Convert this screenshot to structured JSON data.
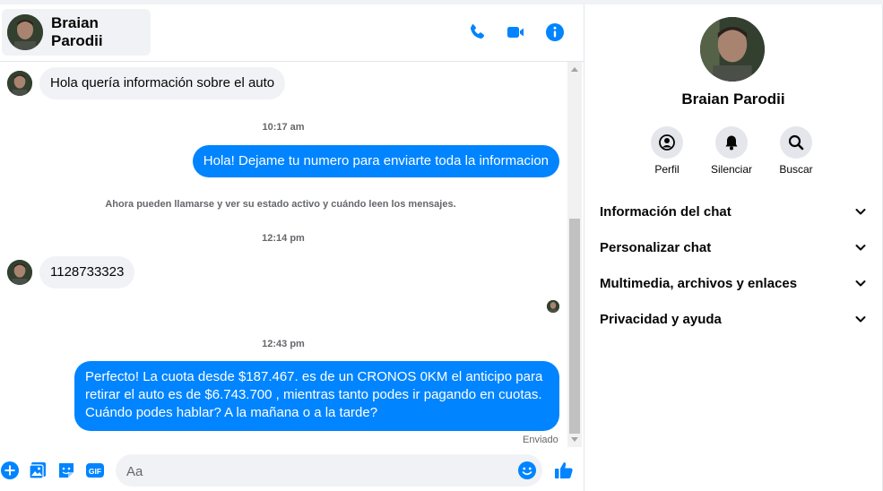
{
  "contact": {
    "name": "Braian Parodii"
  },
  "header": {
    "call_icon": "phone-icon",
    "video_icon": "video-camera-icon",
    "info_icon": "info-icon"
  },
  "messages": [
    {
      "type": "incoming",
      "text": "Hola quería información sobre el auto"
    },
    {
      "type": "timestamp",
      "text": "10:17 am"
    },
    {
      "type": "outgoing",
      "text": "Hola! Dejame tu numero  para enviarte toda la informacion"
    },
    {
      "type": "system",
      "text": "Ahora pueden llamarse y ver su estado activo y cuándo leen los mensajes."
    },
    {
      "type": "timestamp",
      "text": "12:14 pm"
    },
    {
      "type": "incoming",
      "text": "1128733323"
    },
    {
      "type": "timestamp",
      "text": "12:43 pm"
    },
    {
      "type": "outgoing",
      "text": "Perfecto! La cuota desde $187.467. es de un CRONOS 0KM el anticipo para retirar el auto es de $6.743.700 , mientras tanto podes ir pagando en cuotas. Cuándo podes hablar? A la mañana o a la tarde?"
    }
  ],
  "status": {
    "sent": "Enviado"
  },
  "composer": {
    "placeholder": "Aa",
    "value": "",
    "gif_label": "GIF"
  },
  "sidebar": {
    "actions": [
      {
        "label": "Perfil",
        "icon": "profile-icon"
      },
      {
        "label": "Silenciar",
        "icon": "bell-icon"
      },
      {
        "label": "Buscar",
        "icon": "search-icon"
      }
    ],
    "sections": [
      {
        "label": "Información del chat"
      },
      {
        "label": "Personalizar chat"
      },
      {
        "label": "Multimedia, archivos y enlaces"
      },
      {
        "label": "Privacidad y ayuda"
      }
    ]
  },
  "colors": {
    "accent": "#0084ff",
    "bubble_in": "#f0f2f5",
    "muted_text": "#65676b"
  }
}
